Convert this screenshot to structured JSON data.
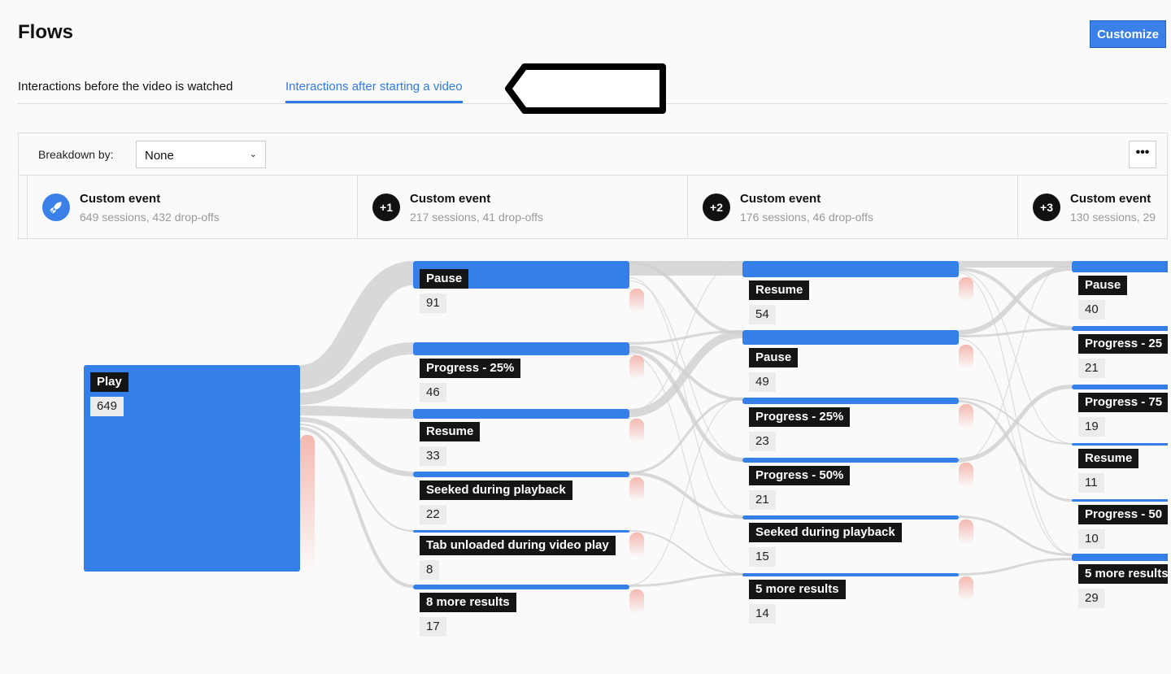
{
  "page": {
    "title": "Flows",
    "customize_label": "Customize"
  },
  "tabs": [
    {
      "label": "Interactions before the video is watched",
      "active": false
    },
    {
      "label": "Interactions after starting a video",
      "active": true
    }
  ],
  "toolbar": {
    "breakdown_label": "Breakdown by:",
    "breakdown_value": "None",
    "more_icon": "ellipsis-icon"
  },
  "steps": [
    {
      "badge": "rocket-icon",
      "title": "Custom event",
      "summary": "649 sessions, 432 drop-offs"
    },
    {
      "badge": "+1",
      "title": "Custom event",
      "summary": "217 sessions, 41 drop-offs"
    },
    {
      "badge": "+2",
      "title": "Custom event",
      "summary": "176 sessions, 46 drop-offs"
    },
    {
      "badge": "+3",
      "title": "Custom event",
      "summary": "130 sessions, 29"
    }
  ],
  "colors": {
    "accent": "#3480e8",
    "link": "#d4d4d4",
    "dropoff": "#f6c9c4",
    "label_bg": "#151515"
  },
  "columns": [
    [
      {
        "label": "Play",
        "value": "649"
      }
    ],
    [
      {
        "label": "Pause",
        "value": "91"
      },
      {
        "label": "Progress - 25%",
        "value": "46"
      },
      {
        "label": "Resume",
        "value": "33"
      },
      {
        "label": "Seeked during playback",
        "value": "22"
      },
      {
        "label": "Tab unloaded during video play",
        "value": "8"
      },
      {
        "label": "8 more results",
        "value": "17"
      }
    ],
    [
      {
        "label": "Resume",
        "value": "54"
      },
      {
        "label": "Pause",
        "value": "49"
      },
      {
        "label": "Progress - 25%",
        "value": "23"
      },
      {
        "label": "Progress - 50%",
        "value": "21"
      },
      {
        "label": "Seeked during playback",
        "value": "15"
      },
      {
        "label": "5 more results",
        "value": "14"
      }
    ],
    [
      {
        "label": "Pause",
        "value": "40"
      },
      {
        "label": "Progress - 25",
        "value": "21"
      },
      {
        "label": "Progress - 75",
        "value": "19"
      },
      {
        "label": "Resume",
        "value": "11"
      },
      {
        "label": "Progress - 50",
        "value": "10"
      },
      {
        "label": "5 more results",
        "value": "29"
      }
    ]
  ]
}
